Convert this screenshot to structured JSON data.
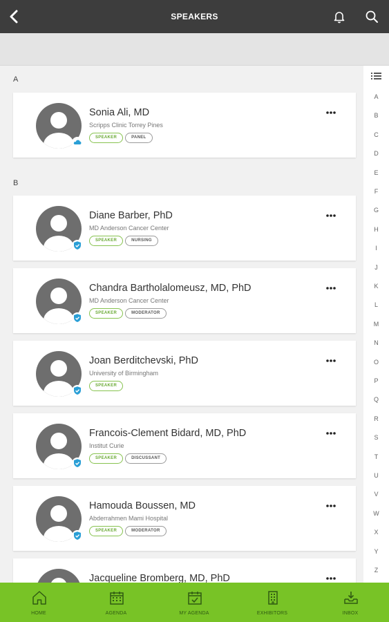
{
  "header": {
    "title": "SPEAKERS"
  },
  "sections": [
    {
      "letter": "A"
    },
    {
      "letter": "B"
    }
  ],
  "speakers": [
    {
      "name": "Sonia Ali, MD",
      "org": "Scripps Clinic Torrey Pines",
      "tags": [
        "SPEAKER",
        "PANEL"
      ],
      "badge": "cloud-icon"
    },
    {
      "name": "Diane Barber, PhD",
      "org": "MD Anderson Cancer Center",
      "tags": [
        "SPEAKER",
        "NURSING"
      ],
      "badge": "verified-icon"
    },
    {
      "name": "Chandra Bartholalomeusz, MD, PhD",
      "org": "MD Anderson Cancer Center",
      "tags": [
        "SPEAKER",
        "MODERATOR"
      ],
      "badge": "verified-icon"
    },
    {
      "name": "Joan Berditchevski, PhD",
      "org": "University of Birmingham",
      "tags": [
        "SPEAKER"
      ],
      "badge": "verified-icon"
    },
    {
      "name": "Francois-Clement Bidard, MD, PhD",
      "org": "Institut Curie",
      "tags": [
        "SPEAKER",
        "DISCUSSANT"
      ],
      "badge": "verified-icon"
    },
    {
      "name": "Hamouda Boussen, MD",
      "org": "Abderrahmen Mami Hospital",
      "tags": [
        "SPEAKER",
        "MODERATOR"
      ],
      "badge": "verified-icon"
    },
    {
      "name": "Jacqueline Bromberg, MD, PhD",
      "org": "",
      "tags": [],
      "badge": ""
    }
  ],
  "alpha_index": [
    "A",
    "B",
    "C",
    "D",
    "E",
    "F",
    "G",
    "H",
    "I",
    "J",
    "K",
    "L",
    "M",
    "N",
    "O",
    "P",
    "Q",
    "R",
    "S",
    "T",
    "U",
    "V",
    "W",
    "X",
    "Y",
    "Z"
  ],
  "tabs": [
    {
      "label": "HOME",
      "icon": "home-icon"
    },
    {
      "label": "AGENDA",
      "icon": "calendar-icon"
    },
    {
      "label": "MY AGENDA",
      "icon": "calendar-check-icon"
    },
    {
      "label": "EXHIBITORS",
      "icon": "building-icon"
    },
    {
      "label": "INBOX",
      "icon": "inbox-icon"
    }
  ],
  "colors": {
    "topbar": "#3d3d3d",
    "accent_green": "#78c326",
    "tag_green": "#6aa934",
    "badge_blue": "#2a9fd6"
  }
}
